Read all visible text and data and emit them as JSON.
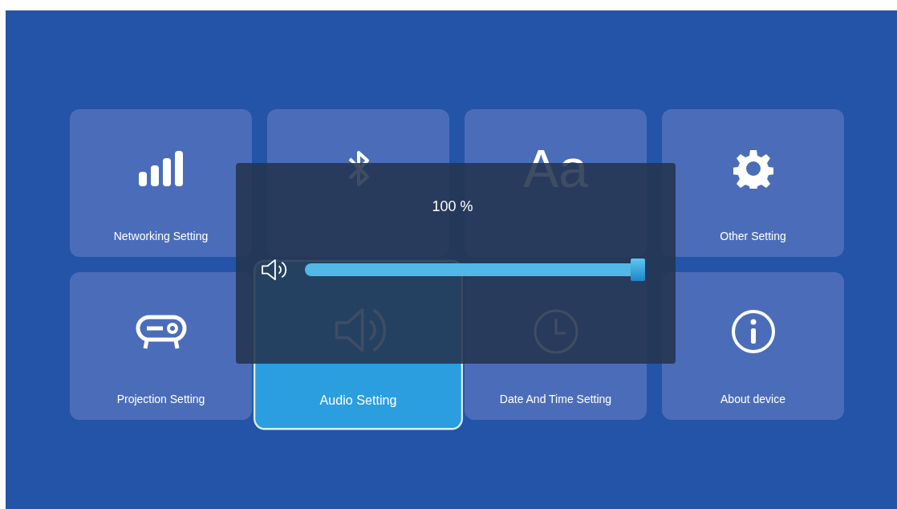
{
  "tiles": [
    {
      "label": "Networking Setting",
      "kind": "signal",
      "selected": false
    },
    {
      "kind": "bluetooth",
      "selected": false
    },
    {
      "kind": "glyph",
      "glyph": "Aa",
      "selected": false
    },
    {
      "label": "Other Setting",
      "kind": "gear",
      "selected": false
    },
    {
      "label": "Projection Setting",
      "kind": "projector",
      "selected": false
    },
    {
      "label": "Audio Setting",
      "kind": "speaker",
      "selected": true
    },
    {
      "label": "Date And Time Setting",
      "kind": "clock",
      "selected": false
    },
    {
      "label": "About device",
      "kind": "info",
      "selected": false
    }
  ],
  "volume_dialog": {
    "reading": "100 %",
    "level": 1.0
  }
}
